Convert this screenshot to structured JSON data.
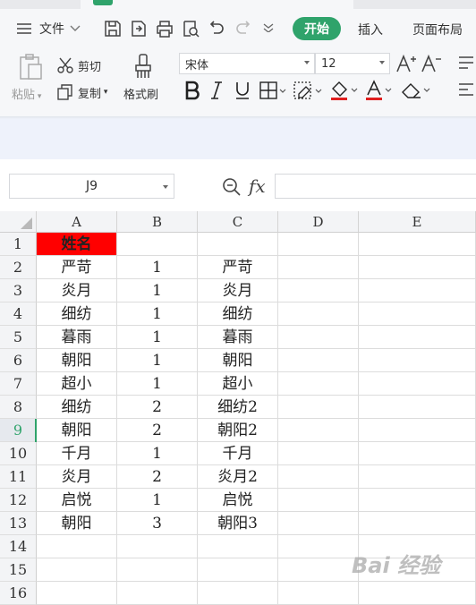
{
  "menu": {
    "file_label": "文件"
  },
  "tabs": {
    "start": "开始",
    "insert": "插入",
    "page_layout": "页面布局"
  },
  "clipboard": {
    "cut": "剪切",
    "paste": "粘贴",
    "copy": "复制",
    "format_painter": "格式刷"
  },
  "font": {
    "name": "宋体",
    "size": "12"
  },
  "name_box": {
    "value": "J9"
  },
  "formula_bar": {
    "fx": "fx",
    "value": ""
  },
  "sheet": {
    "columns": [
      "A",
      "B",
      "C",
      "D",
      "E"
    ],
    "rows": [
      {
        "num": "1",
        "cells": [
          "姓名",
          "",
          "",
          "",
          ""
        ]
      },
      {
        "num": "2",
        "cells": [
          "严苛",
          "1",
          "严苛",
          "",
          ""
        ]
      },
      {
        "num": "3",
        "cells": [
          "炎月",
          "1",
          "炎月",
          "",
          ""
        ]
      },
      {
        "num": "4",
        "cells": [
          "细纺",
          "1",
          "细纺",
          "",
          ""
        ]
      },
      {
        "num": "5",
        "cells": [
          "暮雨",
          "1",
          "暮雨",
          "",
          ""
        ]
      },
      {
        "num": "6",
        "cells": [
          "朝阳",
          "1",
          "朝阳",
          "",
          ""
        ]
      },
      {
        "num": "7",
        "cells": [
          "超小",
          "1",
          "超小",
          "",
          ""
        ]
      },
      {
        "num": "8",
        "cells": [
          "细纺",
          "2",
          "细纺2",
          "",
          ""
        ]
      },
      {
        "num": "9",
        "cells": [
          "朝阳",
          "2",
          "朝阳2",
          "",
          ""
        ]
      },
      {
        "num": "10",
        "cells": [
          "千月",
          "1",
          "千月",
          "",
          ""
        ]
      },
      {
        "num": "11",
        "cells": [
          "炎月",
          "2",
          "炎月2",
          "",
          ""
        ]
      },
      {
        "num": "12",
        "cells": [
          "启悦",
          "1",
          "启悦",
          "",
          ""
        ]
      },
      {
        "num": "13",
        "cells": [
          "朝阳",
          "3",
          "朝阳3",
          "",
          ""
        ]
      },
      {
        "num": "14",
        "cells": [
          "",
          "",
          "",
          "",
          ""
        ]
      },
      {
        "num": "15",
        "cells": [
          "",
          "",
          "",
          "",
          ""
        ]
      },
      {
        "num": "16",
        "cells": [
          "",
          "",
          "",
          "",
          ""
        ]
      }
    ]
  },
  "colors": {
    "accent": "#2fa36b",
    "header_cell_fill": "#ff0000",
    "font_color_bar": "#e02020"
  },
  "watermark": "Bai 经验"
}
